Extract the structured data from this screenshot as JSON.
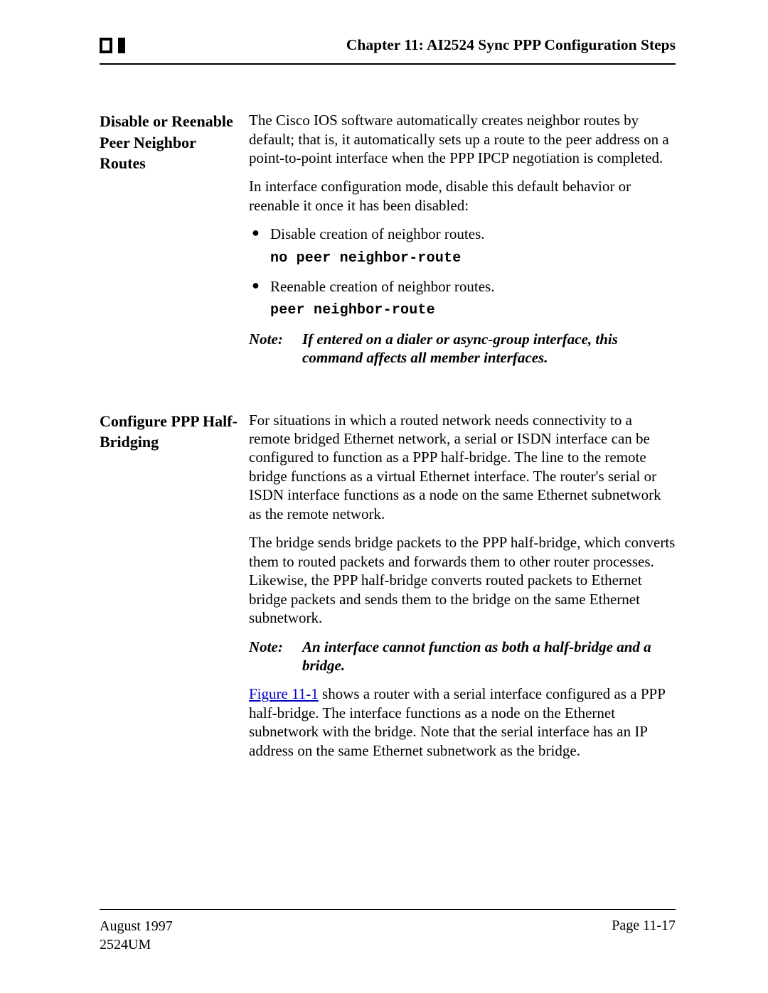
{
  "header": {
    "chapter_title": "Chapter 11: AI2524 Sync PPP Configuration Steps"
  },
  "sections": [
    {
      "heading": "Disable or Reenable Peer Neighbor Routes",
      "paragraphs_top": [
        "The Cisco IOS software automatically creates neighbor routes by default; that is, it automatically sets up a route to the peer address on a point-to-point interface when the PPP IPCP negotiation is completed.",
        "In interface configuration mode, disable this default behavior or reenable it once it has been disabled:"
      ],
      "bullets": [
        {
          "text": "Disable creation of neighbor routes.",
          "command": "no peer neighbor-route"
        },
        {
          "text": "Reenable creation of neighbor routes.",
          "command": "peer neighbor-route"
        }
      ],
      "note": {
        "label": "Note:",
        "text": "If entered on a dialer or async-group interface, this command affects all member interfaces."
      }
    },
    {
      "heading": "Configure PPP Half-Bridging",
      "paragraphs_top": [
        "For situations in which a routed network needs connectivity to a remote bridged Ethernet network, a serial or ISDN interface can be configured to function as a PPP half-bridge. The line to the remote bridge functions as a virtual Ethernet interface. The router's serial or ISDN interface functions as a node on the same Ethernet subnetwork as the remote network.",
        "The bridge sends bridge packets to the PPP half-bridge, which converts them to routed packets and forwards them to other router processes. Likewise, the PPP half-bridge converts routed packets to Ethernet bridge packets and sends them to the bridge on the same Ethernet subnetwork."
      ],
      "note": {
        "label": "Note:",
        "text": "An interface cannot function as both a half-bridge and a bridge."
      },
      "figure_ref": {
        "link_text": "Figure 11-1",
        "rest": " shows a router with a serial interface configured as a PPP half-bridge. The interface functions as a node on the Ethernet subnetwork with the bridge. Note that the serial interface has an IP address on the same Ethernet subnetwork as the bridge."
      }
    }
  ],
  "footer": {
    "date": "August 1997",
    "doc_id": "2524UM",
    "page": "Page 11-17"
  }
}
